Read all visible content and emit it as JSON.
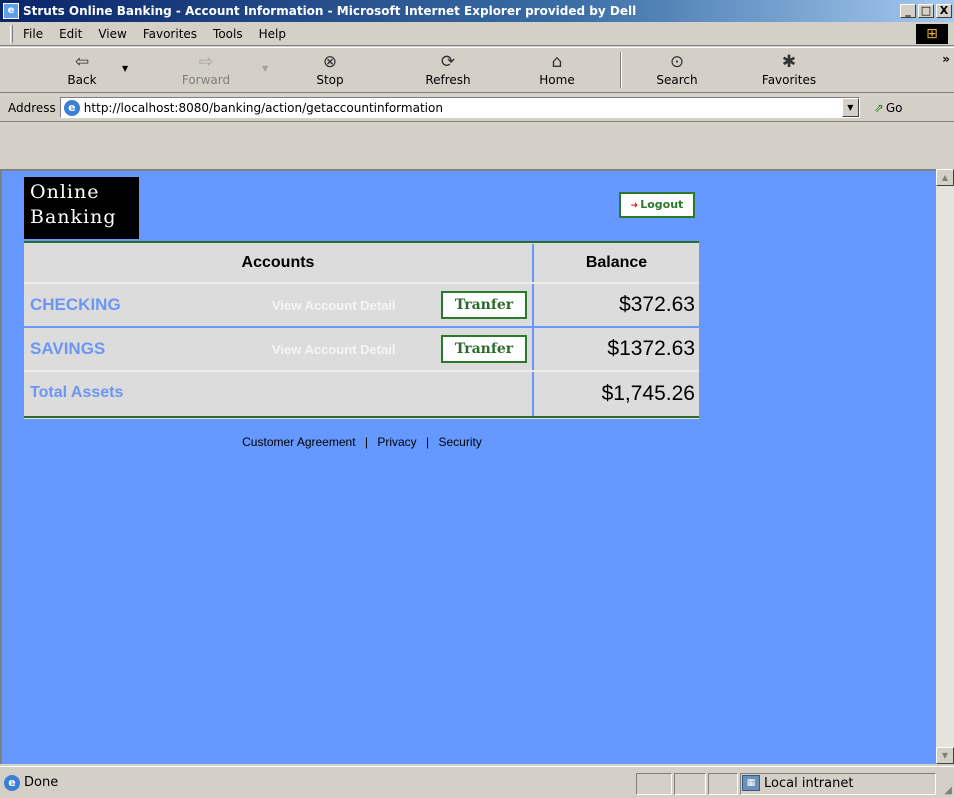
{
  "window": {
    "title": "Struts Online Banking - Account Information - Microsoft Internet Explorer provided by Dell",
    "minimize": "_",
    "maximize": "□",
    "close": "X"
  },
  "menu": [
    "File",
    "Edit",
    "View",
    "Favorites",
    "Tools",
    "Help"
  ],
  "toolbar": {
    "back": {
      "label": "Back",
      "icon": "⇦"
    },
    "forward": {
      "label": "Forward",
      "icon": "⇨"
    },
    "stop": {
      "label": "Stop",
      "icon": "⊗"
    },
    "refresh": {
      "label": "Refresh",
      "icon": "⟳"
    },
    "home": {
      "label": "Home",
      "icon": "⌂"
    },
    "search": {
      "label": "Search",
      "icon": "⊙"
    },
    "favorites": {
      "label": "Favorites",
      "icon": "✱"
    },
    "more": "»"
  },
  "address": {
    "label": "Address",
    "url": "http://localhost:8080/banking/action/getaccountinformation",
    "go_label": "Go"
  },
  "page": {
    "logo": "Online Banking",
    "logo_line1": "Online",
    "logo_line2": "Banking",
    "logout": "Logout",
    "header": {
      "accounts": "Accounts",
      "balance": "Balance"
    },
    "accounts": [
      {
        "name": "CHECKING",
        "detail_link": "View Account Detail",
        "transfer": "Tranfer",
        "balance": "$372.63"
      },
      {
        "name": "SAVINGS",
        "detail_link": "View Account Detail",
        "transfer": "Tranfer",
        "balance": "$1372.63"
      }
    ],
    "total": {
      "label": "Total Assets",
      "balance": "$1,745.26"
    },
    "footer": {
      "agreement": "Customer Agreement",
      "privacy": "Privacy",
      "security": "Security",
      "separator": "|"
    }
  },
  "status": {
    "text": "Done",
    "zone": "Local intranet"
  },
  "colors": {
    "page_background": "#6699ff",
    "accent_green": "#2b7a2b",
    "account_link": "#6b96f4"
  }
}
